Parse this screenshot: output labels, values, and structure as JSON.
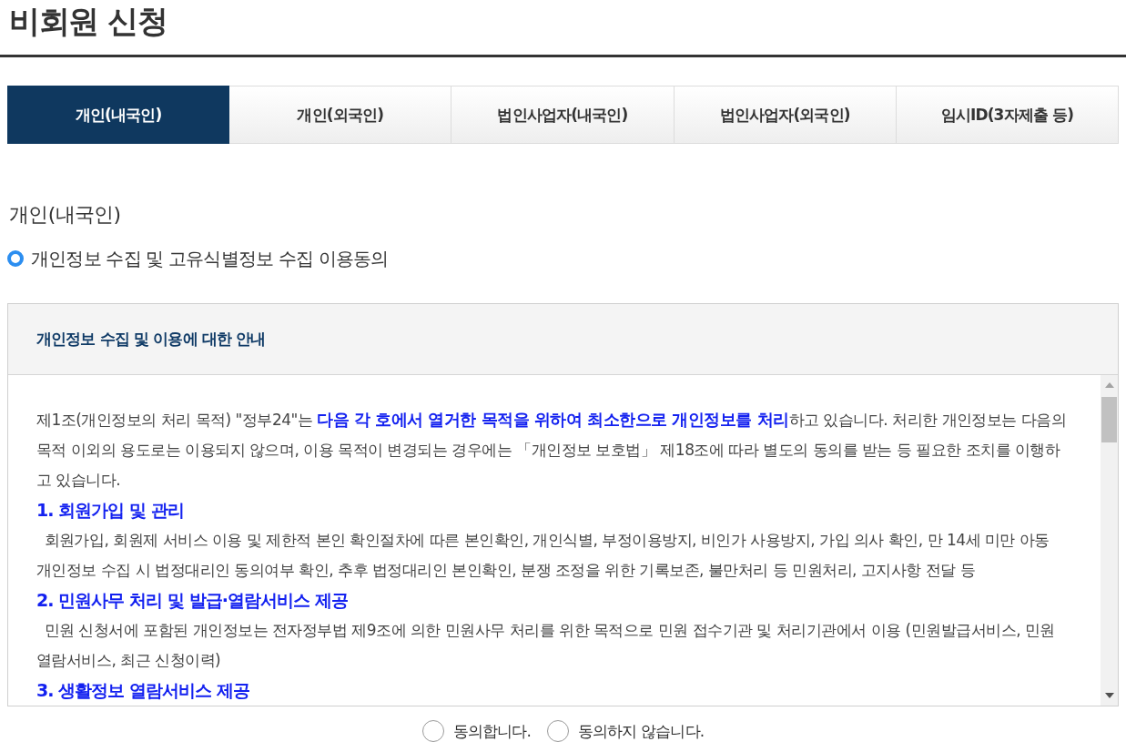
{
  "page_title": "비회원 신청",
  "tabs": [
    {
      "label": "개인(내국인)",
      "selected": true
    },
    {
      "label": "개인(외국인)",
      "selected": false
    },
    {
      "label": "법인사업자(내국인)",
      "selected": false
    },
    {
      "label": "법인사업자(외국인)",
      "selected": false
    },
    {
      "label": "임시ID(3자제출 등)",
      "selected": false
    }
  ],
  "section_title": "개인(내국인)",
  "consent_heading": "개인정보 수집 및 고유식별정보 수집 이용동의",
  "notice": {
    "title": "개인정보 수집 및 이용에 대한 안내",
    "intro": "제1조(개인정보의 처리 목적) \"정부24\"는 **다음 각 호에서 열거한 목적을 위하여 최소한으로 개인정보를 처리**하고 있습니다. 처리한 개인정보는 다음의 목적 이외의 용도로는 이용되지 않으며, 이용 목적이 변경되는 경우에는 「개인정보 보호법」 제18조에 따라 별도의 동의를 받는 등 필요한 조치를 이행하고 있습니다.",
    "items": [
      {
        "heading": "1. 회원가입 및 관리",
        "body": "회원가입, 회원제 서비스 이용 및 제한적 본인 확인절차에 따른 본인확인, 개인식별, 부정이용방지, 비인가 사용방지, 가입 의사 확인, 만 14세 미만 아동 개인정보 수집 시 법정대리인 동의여부 확인, 추후 법정대리인 본인확인, 분쟁 조정을 위한 기록보존, 불만처리 등 민원처리, 고지사항 전달 등"
      },
      {
        "heading": "2. 민원사무 처리 및 발급·열람서비스 제공",
        "body": "민원 신청서에 포함된 개인정보는 전자정부법 제9조에 의한 민원사무 처리를 위한 목적으로 민원 접수기관 및 처리기관에서 이용 (민원발급서비스, 민원열람서비스, 최근 신청이력)"
      },
      {
        "heading": "3. 생활정보 열람서비스 제공"
      }
    ]
  },
  "agree_options": [
    {
      "label": "동의합니다.",
      "selected": false
    },
    {
      "label": "동의하지 않습니다.",
      "selected": false
    }
  ]
}
